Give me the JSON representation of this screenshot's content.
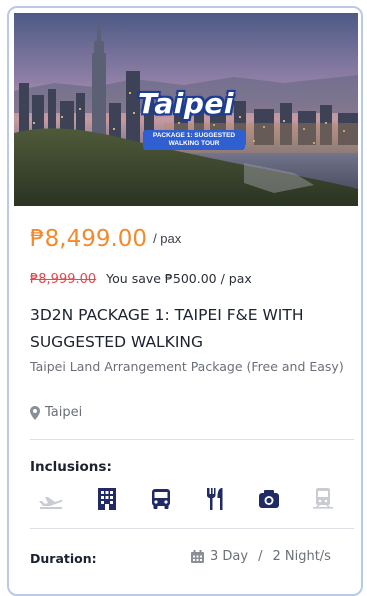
{
  "hero": {
    "city": "Taipei",
    "banner_line1": "PACKAGE 1: SUGGESTED",
    "banner_line2": "WALKING TOUR"
  },
  "pricing": {
    "price": "₱8,499.00",
    "per_pax": "/ pax",
    "original_price": "₱8,999.00",
    "savings": "You save ₱500.00 / pax"
  },
  "package": {
    "title": "3D2N PACKAGE 1: TAIPEI F&E WITH SUGGESTED WALKING",
    "subtitle": "Taipei Land Arrangement Package (Free and Easy)",
    "location": "Taipei"
  },
  "inclusions": {
    "label": "Inclusions:",
    "items": [
      {
        "icon": "plane-icon",
        "included": false
      },
      {
        "icon": "hotel-icon",
        "included": true
      },
      {
        "icon": "bus-icon",
        "included": true
      },
      {
        "icon": "meals-icon",
        "included": true
      },
      {
        "icon": "camera-icon",
        "included": true
      },
      {
        "icon": "train-icon",
        "included": false
      }
    ]
  },
  "duration": {
    "label": "Duration:",
    "days": "3 Day",
    "separator": "/",
    "nights": "2 Night/s"
  },
  "colors": {
    "price": "#f28a2e",
    "old_price": "#e5484d",
    "icon_active": "#1f2a66",
    "icon_inactive": "#c9ccd2",
    "card_border": "#b9c9ea",
    "banner": "#2f5fd0"
  }
}
